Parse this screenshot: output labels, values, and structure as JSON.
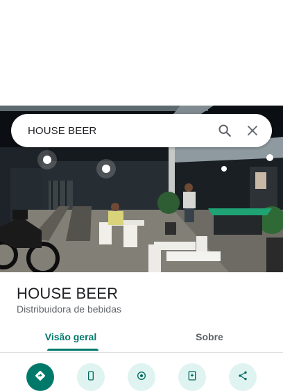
{
  "search": {
    "query": "HOUSE BEER"
  },
  "place": {
    "name": "HOUSE BEER",
    "category": "Distribuidora de bebidas"
  },
  "tabs": [
    {
      "label": "Visão geral",
      "active": true
    },
    {
      "label": "Sobre",
      "active": false
    }
  ],
  "actions": [
    {
      "icon": "directions-icon"
    },
    {
      "icon": "phone-icon"
    },
    {
      "icon": "location-icon"
    },
    {
      "icon": "save-icon"
    },
    {
      "icon": "share-icon"
    }
  ],
  "colors": {
    "accent": "#00796b",
    "action_bg": "#dff3f1",
    "text_primary": "#202124",
    "text_secondary": "#5f6368"
  }
}
